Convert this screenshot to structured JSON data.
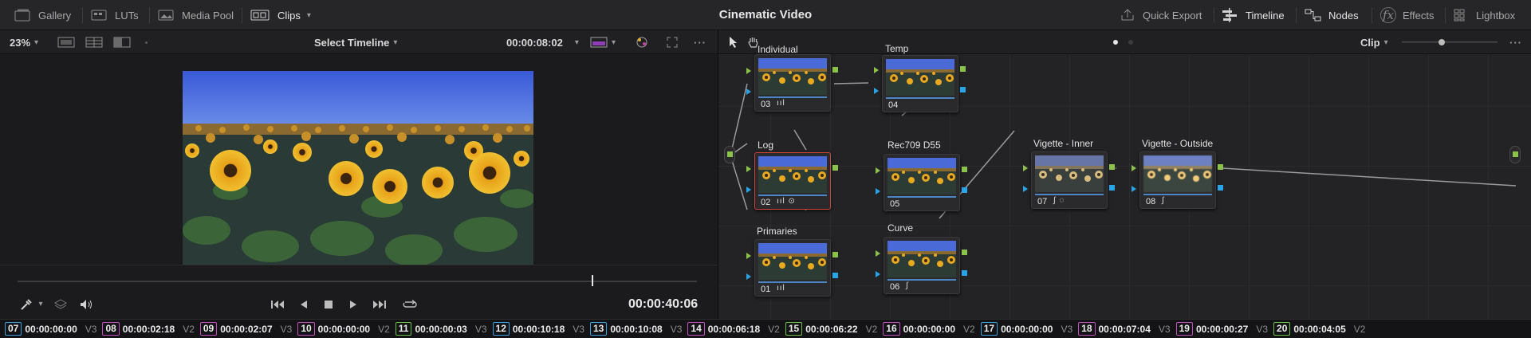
{
  "topbar": {
    "gallery": "Gallery",
    "luts": "LUTs",
    "media_pool": "Media Pool",
    "clips": "Clips",
    "project_title": "Cinematic Video",
    "quick_export": "Quick Export",
    "timeline": "Timeline",
    "nodes": "Nodes",
    "effects": "Effects",
    "lightbox": "Lightbox"
  },
  "viewer_bar": {
    "zoom": "23%",
    "select_timeline": "Select Timeline",
    "timecode": "00:00:08:02"
  },
  "node_bar": {
    "mode": "Clip"
  },
  "transport": {
    "timecode": "00:00:40:06"
  },
  "nodes": [
    {
      "id": "03",
      "label": "Individual",
      "icons": "ııl"
    },
    {
      "id": "04",
      "label": "Temp",
      "icons": ""
    },
    {
      "id": "02",
      "label": "Log",
      "icons": "ııl ⊙"
    },
    {
      "id": "05",
      "label": "Rec709 D55",
      "icons": ""
    },
    {
      "id": "01",
      "label": "Primaries",
      "icons": "ııl"
    },
    {
      "id": "06",
      "label": "Curve",
      "icons": "∫"
    },
    {
      "id": "07",
      "label": "Vigette - Inner",
      "icons": "∫ ◌"
    },
    {
      "id": "08",
      "label": "Vigette - Outside",
      "icons": "∫"
    }
  ],
  "clips": [
    {
      "num": "07",
      "tc": "00:00:00:00",
      "track": "V3",
      "color": "#3aa0e0"
    },
    {
      "num": "08",
      "tc": "00:00:02:18",
      "track": "V2",
      "color": "#c050c0"
    },
    {
      "num": "09",
      "tc": "00:00:02:07",
      "track": "V3",
      "color": "#c050c0"
    },
    {
      "num": "10",
      "tc": "00:00:00:00",
      "track": "V2",
      "color": "#c050c0"
    },
    {
      "num": "11",
      "tc": "00:00:00:03",
      "track": "V3",
      "color": "#6cc04a"
    },
    {
      "num": "12",
      "tc": "00:00:10:18",
      "track": "V3",
      "color": "#3aa0e0"
    },
    {
      "num": "13",
      "tc": "00:00:10:08",
      "track": "V3",
      "color": "#3aa0e0"
    },
    {
      "num": "14",
      "tc": "00:00:06:18",
      "track": "V2",
      "color": "#c050c0"
    },
    {
      "num": "15",
      "tc": "00:00:06:22",
      "track": "V2",
      "color": "#6cc04a"
    },
    {
      "num": "16",
      "tc": "00:00:00:00",
      "track": "V2",
      "color": "#c050c0"
    },
    {
      "num": "17",
      "tc": "00:00:00:00",
      "track": "V3",
      "color": "#3aa0e0"
    },
    {
      "num": "18",
      "tc": "00:00:07:04",
      "track": "V3",
      "color": "#c050c0"
    },
    {
      "num": "19",
      "tc": "00:00:00:27",
      "track": "V3",
      "color": "#c050c0"
    },
    {
      "num": "20",
      "tc": "00:00:04:05",
      "track": "V2",
      "color": "#6cc04a"
    }
  ],
  "colors": {
    "accent": "#e6e6e6",
    "pin_green": "#8bc34a",
    "pin_blue": "#29a4e6",
    "selected": "#d0453a"
  }
}
